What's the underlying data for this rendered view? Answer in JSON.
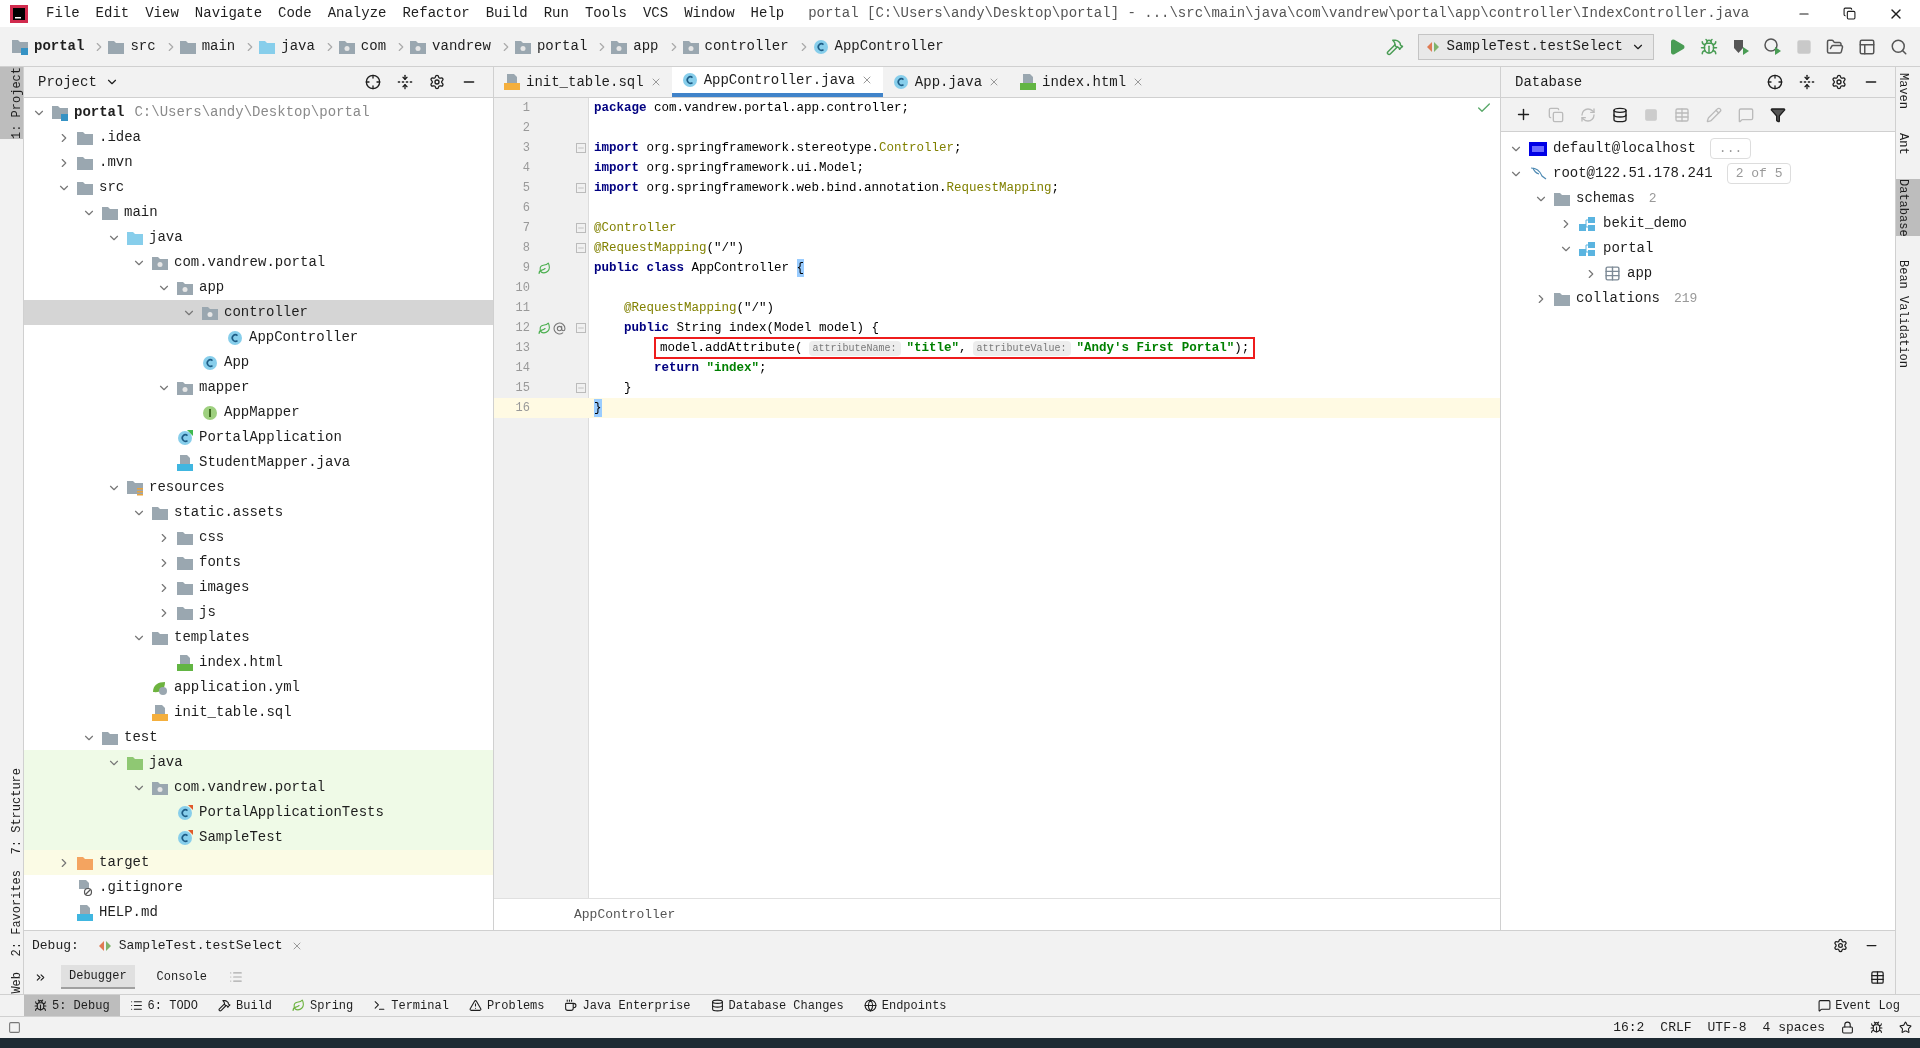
{
  "window": {
    "title": "portal [C:\\Users\\andy\\Desktop\\portal] - ...\\src\\main\\java\\com\\vandrew\\portal\\app\\controller\\IndexController.java"
  },
  "menu": [
    "File",
    "Edit",
    "View",
    "Navigate",
    "Code",
    "Analyze",
    "Refactor",
    "Build",
    "Run",
    "Tools",
    "VCS",
    "Window",
    "Help"
  ],
  "breadcrumb": [
    {
      "label": "portal",
      "kind": "project"
    },
    {
      "label": "src",
      "kind": "folder"
    },
    {
      "label": "main",
      "kind": "folder"
    },
    {
      "label": "java",
      "kind": "source"
    },
    {
      "label": "com",
      "kind": "package"
    },
    {
      "label": "vandrew",
      "kind": "package"
    },
    {
      "label": "portal",
      "kind": "package"
    },
    {
      "label": "app",
      "kind": "package"
    },
    {
      "label": "controller",
      "kind": "package"
    },
    {
      "label": "AppController",
      "kind": "class"
    }
  ],
  "run_config": "SampleTest.testSelect",
  "left_stripe": [
    {
      "label": "1: Project",
      "selected": true
    },
    {
      "label": "7: Structure",
      "selected": false
    },
    {
      "label": "2: Favorites",
      "selected": false
    },
    {
      "label": "Web",
      "selected": false
    }
  ],
  "right_stripe": [
    {
      "label": "Maven",
      "selected": false
    },
    {
      "label": "Ant",
      "selected": false
    },
    {
      "label": "Database",
      "selected": true
    },
    {
      "label": "Bean Validation",
      "selected": false
    }
  ],
  "project_panel": {
    "title": "Project",
    "tree": [
      {
        "label": "portal",
        "path": "C:\\Users\\andy\\Desktop\\portal",
        "kind": "module",
        "expanded": true,
        "selected": false,
        "test": false,
        "excluded": false,
        "children": [
          {
            "label": ".idea",
            "kind": "folder",
            "expanded": false,
            "selected": false,
            "test": false,
            "excluded": false
          },
          {
            "label": ".mvn",
            "kind": "folder",
            "expanded": false,
            "selected": false,
            "test": false,
            "excluded": false
          },
          {
            "label": "src",
            "kind": "folder",
            "expanded": true,
            "selected": false,
            "test": false,
            "excluded": false,
            "children": [
              {
                "label": "main",
                "kind": "folder",
                "expanded": true,
                "selected": false,
                "test": false,
                "excluded": false,
                "children": [
                  {
                    "label": "java",
                    "kind": "source",
                    "expanded": true,
                    "selected": false,
                    "test": false,
                    "excluded": false,
                    "children": [
                      {
                        "label": "com.vandrew.portal",
                        "kind": "package",
                        "expanded": true,
                        "selected": false,
                        "test": false,
                        "excluded": false,
                        "children": [
                          {
                            "label": "app",
                            "kind": "package",
                            "expanded": true,
                            "selected": false,
                            "test": false,
                            "excluded": false,
                            "children": [
                              {
                                "label": "controller",
                                "kind": "package",
                                "expanded": true,
                                "selected": true,
                                "test": false,
                                "excluded": false,
                                "children": [
                                  {
                                    "label": "AppController",
                                    "kind": "class",
                                    "selected": false,
                                    "test": false,
                                    "excluded": false
                                  }
                                ]
                              },
                              {
                                "label": "App",
                                "kind": "class",
                                "selected": false,
                                "test": false,
                                "excluded": false
                              }
                            ]
                          },
                          {
                            "label": "mapper",
                            "kind": "package",
                            "expanded": true,
                            "selected": false,
                            "test": false,
                            "excluded": false,
                            "children": [
                              {
                                "label": "AppMapper",
                                "kind": "interface",
                                "selected": false,
                                "test": false,
                                "excluded": false
                              }
                            ]
                          },
                          {
                            "label": "PortalApplication",
                            "kind": "boot-class",
                            "selected": false,
                            "test": false,
                            "excluded": false
                          },
                          {
                            "label": "StudentMapper.java",
                            "kind": "java-file",
                            "selected": false,
                            "test": false,
                            "excluded": false
                          }
                        ]
                      }
                    ]
                  },
                  {
                    "label": "resources",
                    "kind": "resources",
                    "expanded": true,
                    "selected": false,
                    "test": false,
                    "excluded": false,
                    "children": [
                      {
                        "label": "static.assets",
                        "kind": "folder",
                        "expanded": true,
                        "selected": false,
                        "test": false,
                        "excluded": false,
                        "children": [
                          {
                            "label": "css",
                            "kind": "folder",
                            "expanded": false,
                            "selected": false,
                            "test": false,
                            "excluded": false
                          },
                          {
                            "label": "fonts",
                            "kind": "folder",
                            "expanded": false,
                            "selected": false,
                            "test": false,
                            "excluded": false
                          },
                          {
                            "label": "images",
                            "kind": "folder",
                            "expanded": false,
                            "selected": false,
                            "test": false,
                            "excluded": false
                          },
                          {
                            "label": "js",
                            "kind": "folder",
                            "expanded": false,
                            "selected": false,
                            "test": false,
                            "excluded": false
                          }
                        ]
                      },
                      {
                        "label": "templates",
                        "kind": "folder",
                        "expanded": true,
                        "selected": false,
                        "test": false,
                        "excluded": false,
                        "children": [
                          {
                            "label": "index.html",
                            "kind": "html",
                            "selected": false,
                            "test": false,
                            "excluded": false
                          }
                        ]
                      },
                      {
                        "label": "application.yml",
                        "kind": "yml",
                        "selected": false,
                        "test": false,
                        "excluded": false
                      },
                      {
                        "label": "init_table.sql",
                        "kind": "sql",
                        "selected": false,
                        "test": false,
                        "excluded": false
                      }
                    ]
                  }
                ]
              },
              {
                "label": "test",
                "kind": "folder",
                "expanded": true,
                "selected": false,
                "test": false,
                "excluded": false,
                "children": [
                  {
                    "label": "java",
                    "kind": "test-source",
                    "expanded": true,
                    "selected": false,
                    "test": true,
                    "excluded": false,
                    "children": [
                      {
                        "label": "com.vandrew.portal",
                        "kind": "package",
                        "expanded": true,
                        "selected": false,
                        "test": true,
                        "excluded": false,
                        "children": [
                          {
                            "label": "PortalApplicationTests",
                            "kind": "test-class",
                            "selected": false,
                            "test": true,
                            "excluded": false
                          },
                          {
                            "label": "SampleTest",
                            "kind": "test-class",
                            "selected": false,
                            "test": true,
                            "excluded": false
                          }
                        ]
                      }
                    ]
                  }
                ]
              }
            ]
          },
          {
            "label": "target",
            "kind": "excluded",
            "expanded": false,
            "selected": false,
            "test": false,
            "excluded": true
          },
          {
            "label": ".gitignore",
            "kind": "ignore-file",
            "selected": false,
            "test": false,
            "excluded": false
          },
          {
            "label": "HELP.md",
            "kind": "md-file",
            "selected": false,
            "test": false,
            "excluded": false
          }
        ]
      }
    ]
  },
  "editor_tabs": [
    {
      "label": "init_table.sql",
      "kind": "sql",
      "selected": false
    },
    {
      "label": "AppController.java",
      "kind": "class",
      "selected": true
    },
    {
      "label": "App.java",
      "kind": "class",
      "selected": false
    },
    {
      "label": "index.html",
      "kind": "html",
      "selected": false
    }
  ],
  "code": [
    {
      "number": "1",
      "current": false,
      "boxed": false,
      "tokens": [
        {
          "kind": "kw",
          "t": "package"
        },
        {
          "kind": "plain",
          "t": " com.vandrew.portal.app.controller;"
        }
      ]
    },
    {
      "number": "2",
      "current": false,
      "boxed": false
    },
    {
      "number": "3",
      "current": false,
      "boxed": false,
      "fold": true,
      "tokens": [
        {
          "kind": "kw",
          "t": "import"
        },
        {
          "kind": "plain",
          "t": " org.springframework.stereotype."
        },
        {
          "kind": "ann",
          "t": "Controller"
        },
        {
          "kind": "plain",
          "t": ";"
        }
      ]
    },
    {
      "number": "4",
      "current": false,
      "boxed": false,
      "tokens": [
        {
          "kind": "kw",
          "t": "import"
        },
        {
          "kind": "plain",
          "t": " org.springframework.ui.Model;"
        }
      ]
    },
    {
      "number": "5",
      "current": false,
      "boxed": false,
      "fold": true,
      "tokens": [
        {
          "kind": "kw",
          "t": "import"
        },
        {
          "kind": "plain",
          "t": " org.springframework.web.bind.annotation."
        },
        {
          "kind": "ann",
          "t": "RequestMapping"
        },
        {
          "kind": "plain",
          "t": ";"
        }
      ]
    },
    {
      "number": "6",
      "current": false,
      "boxed": false
    },
    {
      "number": "7",
      "current": false,
      "boxed": false,
      "fold": true,
      "tokens": [
        {
          "kind": "ann",
          "t": "@Controller"
        }
      ]
    },
    {
      "number": "8",
      "current": false,
      "boxed": false,
      "fold": true,
      "tokens": [
        {
          "kind": "ann",
          "t": "@RequestMapping"
        },
        {
          "kind": "plain",
          "t": "(\"/\")"
        }
      ]
    },
    {
      "number": "9",
      "current": false,
      "boxed": false,
      "gutter": [
        {
          "kind": "bean"
        }
      ],
      "tokens": [
        {
          "kind": "kw",
          "t": "public class"
        },
        {
          "kind": "plain",
          "t": " AppController "
        },
        {
          "kind": "brace",
          "t": "{"
        }
      ]
    },
    {
      "number": "10",
      "current": false,
      "boxed": false
    },
    {
      "number": "11",
      "current": false,
      "boxed": false,
      "tokens": [
        {
          "kind": "ann",
          "t": "    @RequestMapping"
        },
        {
          "kind": "plain",
          "t": "(\"/\")"
        }
      ]
    },
    {
      "number": "12",
      "current": false,
      "boxed": false,
      "fold": true,
      "gutter": [
        {
          "kind": "bean"
        },
        {
          "kind": "at"
        }
      ],
      "tokens": [
        {
          "kind": "kw",
          "t": "    public"
        },
        {
          "kind": "plain",
          "t": " String index(Model model) {"
        }
      ]
    },
    {
      "number": "13",
      "current": false,
      "boxed": true,
      "tokens": [
        {
          "kind": "plain",
          "t": "        model.addAttribute("
        },
        {
          "kind": "hint",
          "t": "attributeName:"
        },
        {
          "kind": "str",
          "t": "\"title\""
        },
        {
          "kind": "plain",
          "t": ","
        },
        {
          "kind": "hint",
          "t": "attributeValue:"
        },
        {
          "kind": "str",
          "t": "\"Andy's First Portal\""
        },
        {
          "kind": "plain",
          "t": ");"
        }
      ]
    },
    {
      "number": "14",
      "current": false,
      "boxed": false,
      "tokens": [
        {
          "kind": "kw",
          "t": "        return"
        },
        {
          "kind": "str",
          "t": " \"index\""
        },
        {
          "kind": "plain",
          "t": ";"
        }
      ]
    },
    {
      "number": "15",
      "current": false,
      "boxed": false,
      "fold": true,
      "tokens": [
        {
          "kind": "plain",
          "t": "    }"
        }
      ]
    },
    {
      "number": "16",
      "current": true,
      "boxed": false,
      "tokens": [
        {
          "kind": "brace",
          "t": "}"
        }
      ]
    }
  ],
  "editor_breadcrumb": "AppController",
  "database_panel": {
    "title": "Database",
    "tree": [
      {
        "label": "default@localhost",
        "kind": "h2",
        "expanded": true,
        "badge": "..."
      },
      {
        "label": "root@122.51.178.241",
        "kind": "mysql",
        "expanded": true,
        "badge": "2 of 5",
        "children": [
          {
            "label": "schemas",
            "kind": "folder",
            "count": "2",
            "expanded": true,
            "children": [
              {
                "label": "bekit_demo",
                "kind": "schema",
                "expanded": false
              },
              {
                "label": "portal",
                "kind": "schema",
                "expanded": true,
                "children": [
                  {
                    "label": "app",
                    "kind": "table",
                    "expanded": false
                  }
                ]
              }
            ]
          },
          {
            "label": "collations",
            "kind": "folder",
            "count": "219",
            "expanded": false
          }
        ]
      }
    ]
  },
  "debug": {
    "label": "Debug:",
    "session": "SampleTest.testSelect",
    "tabs": [
      {
        "label": "Debugger",
        "selected": true
      },
      {
        "label": "Console",
        "selected": false
      }
    ]
  },
  "tool_strip": [
    {
      "label": "5: Debug",
      "kind": "bug",
      "selected": true
    },
    {
      "label": "6: TODO",
      "kind": "list",
      "selected": false
    },
    {
      "label": "Build",
      "kind": "hammer",
      "selected": false
    },
    {
      "label": "Spring",
      "kind": "leaf",
      "selected": false
    },
    {
      "label": "Terminal",
      "kind": "terminal",
      "selected": false
    },
    {
      "label": "Problems",
      "kind": "warning",
      "selected": false
    },
    {
      "label": "Java Enterprise",
      "kind": "cup",
      "selected": false
    },
    {
      "label": "Database Changes",
      "kind": "db",
      "selected": false
    },
    {
      "label": "Endpoints",
      "kind": "globe",
      "selected": false
    }
  ],
  "event_log": "Event Log",
  "status_bar": [
    "16:2",
    "CRLF",
    "UTF-8",
    "4 spaces"
  ]
}
